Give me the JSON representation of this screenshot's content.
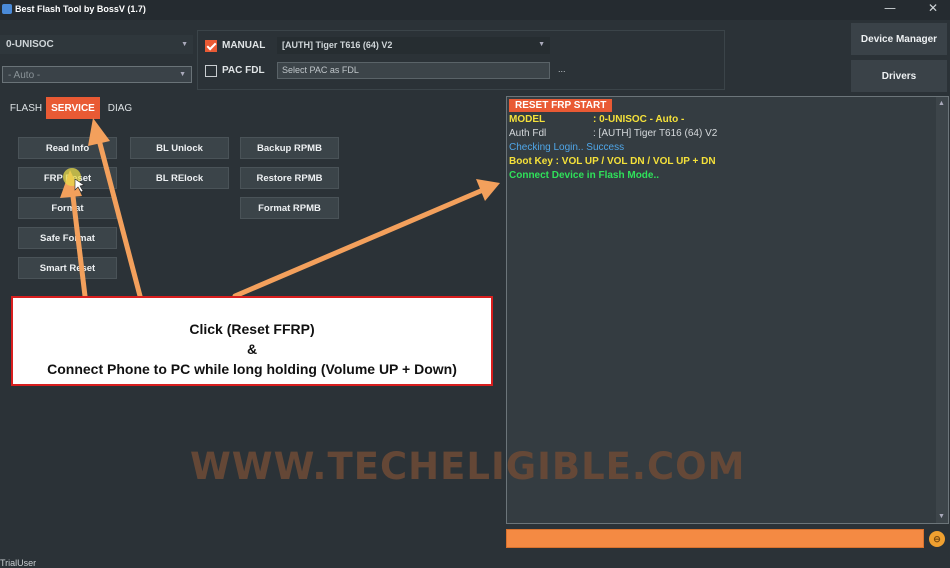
{
  "window": {
    "title": "Best Flash Tool by BossV (1.7)"
  },
  "left_controls": {
    "platform": "0-UNISOC",
    "mode": "- Auto -"
  },
  "options": {
    "manual_label": "MANUAL",
    "manual_checked": true,
    "auth_selected": "[AUTH] Tiger T616 (64) V2",
    "pac_label": "PAC FDL",
    "pac_checked": false,
    "pac_placeholder": "Select PAC as FDL",
    "browse_label": "..."
  },
  "side_buttons": {
    "device_manager": "Device Manager",
    "drivers": "Drivers"
  },
  "tabs": [
    {
      "label": "FLASH",
      "active": false
    },
    {
      "label": "SERVICE",
      "active": true
    },
    {
      "label": "DIAG",
      "active": false
    }
  ],
  "service_buttons": {
    "read_info": "Read Info",
    "frp_reset": "FRP Reset",
    "format": "Format",
    "safe_format": "Safe Format",
    "smart_reset": "Smart Reset",
    "bl_unlock": "BL Unlock",
    "bl_relock": "BL RElock",
    "backup_rpmb": "Backup RPMB",
    "restore_rpmb": "Restore RPMB",
    "format_rpmb": "Format RPMB"
  },
  "log": {
    "header": "RESET FRP START",
    "lines": [
      {
        "key": "MODEL",
        "value": ": 0-UNISOC - Auto -",
        "color": "#f5e13a"
      },
      {
        "key": "Auth Fdl",
        "value": ": [AUTH] Tiger T616 (64) V2",
        "color": "#d6dadd"
      },
      {
        "key": "",
        "value": "Checking Login.. Success",
        "color": "#4fa6e8"
      },
      {
        "key": "",
        "value": "Boot Key : VOL UP / VOL DN / VOL UP + DN",
        "color": "#f5e13a"
      },
      {
        "key": "",
        "value": "Connect Device in Flash Mode..",
        "color": "#2fe25a"
      }
    ]
  },
  "status_bar": {
    "user": "TrialUser"
  },
  "annotation": {
    "line1": "Click (Reset FFRP)",
    "line2": "&",
    "line3": "Connect Phone to PC while long holding (Volume UP + Down)"
  },
  "watermark": "WWW.TECHELIGIBLE.COM",
  "colors": {
    "accent": "#e95a34",
    "progress": "#f48a43",
    "arrow": "#f3a05c",
    "callout_border": "#d81e1e"
  }
}
